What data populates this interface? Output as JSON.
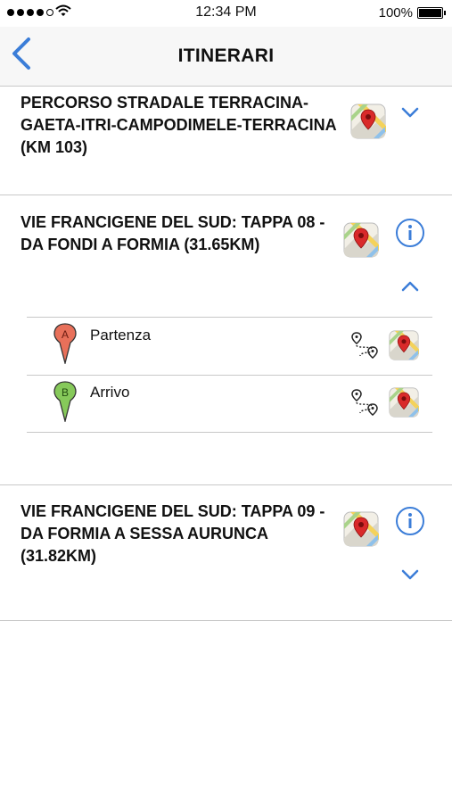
{
  "status_bar": {
    "time": "12:34 PM",
    "battery": "100%"
  },
  "navbar": {
    "title": "ITINERARI",
    "back_icon": "chevron-left-icon"
  },
  "colors": {
    "accent": "#3b7dd8",
    "pin_a": "#e8705a",
    "pin_b": "#86c95a"
  },
  "itineraries": [
    {
      "title": "PERCORSO STRADALE TERRACINA-GAETA-ITRI-CAMPODIMELE-TERRACINA (KM 103)",
      "expanded": false,
      "has_info": false
    },
    {
      "title": "VIE FRANCIGENE DEL SUD: TAPPA 08 - DA FONDI A FORMIA (31.65KM)",
      "expanded": true,
      "has_info": true,
      "stops": [
        {
          "marker": "A",
          "label": "Partenza"
        },
        {
          "marker": "B",
          "label": "Arrivo"
        }
      ]
    },
    {
      "title": "VIE FRANCIGENE DEL SUD: TAPPA 09 - DA FORMIA A SESSA AURUNCA (31.82KM)",
      "expanded": false,
      "has_info": true
    }
  ]
}
